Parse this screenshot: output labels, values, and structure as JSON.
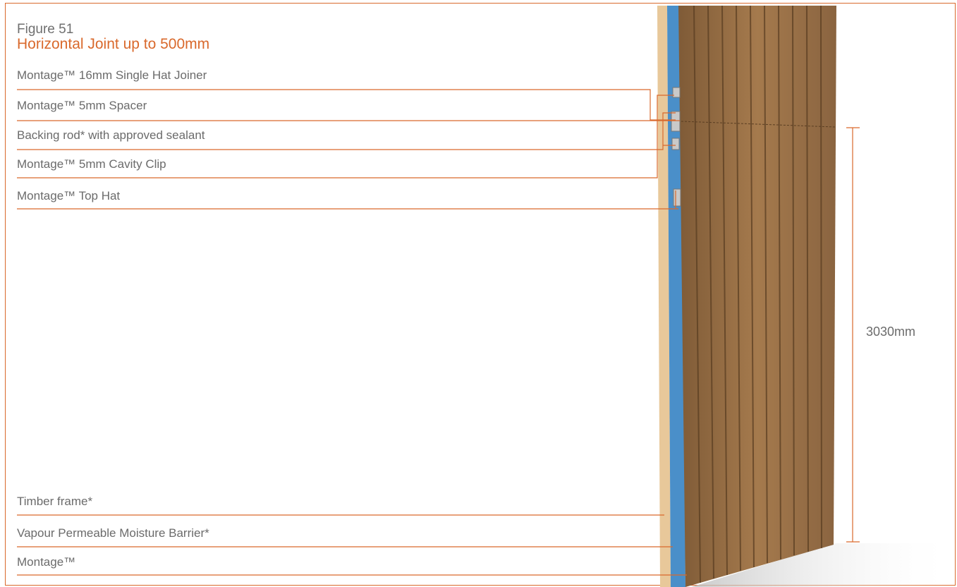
{
  "figure": {
    "number": "Figure 51",
    "title": "Horizontal Joint up to 500mm"
  },
  "labels": {
    "single_hat_joiner": "Montage™ 16mm Single Hat Joiner",
    "spacer": "Montage™ 5mm Spacer",
    "backing_rod": "Backing rod* with approved sealant",
    "cavity_clip": "Montage™ 5mm Cavity Clip",
    "top_hat": "Montage™ Top Hat",
    "timber_frame": "Timber frame*",
    "moisture_barrier": "Vapour Permeable Moisture Barrier*",
    "montage": "Montage™"
  },
  "dimension": {
    "height": "3030mm"
  },
  "colors": {
    "accent": "#d9692c",
    "text": "#6b6b6b",
    "timber": "#e8c89a",
    "barrier": "#4a8fc9",
    "cladding": "#9a6f45"
  }
}
